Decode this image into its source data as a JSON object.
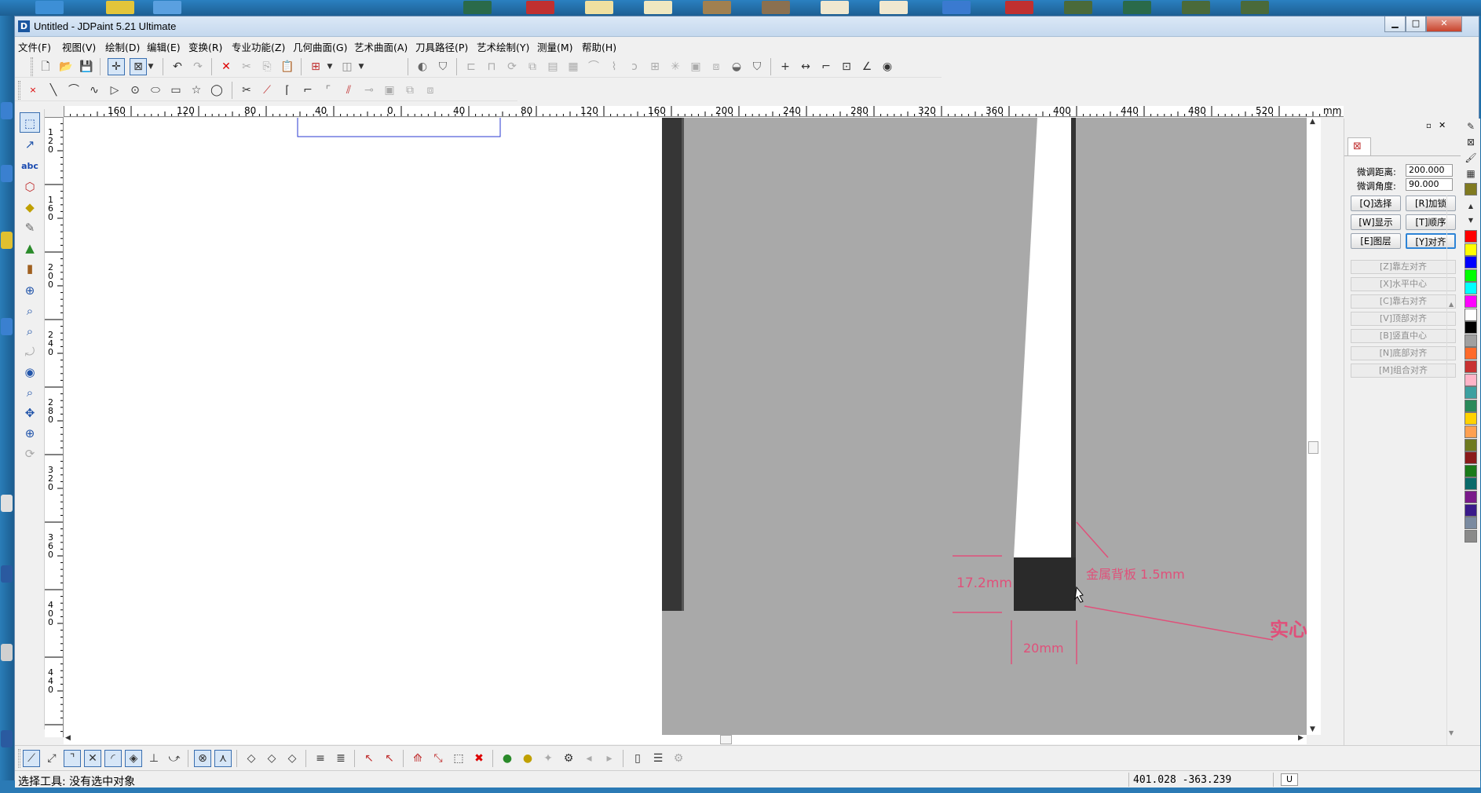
{
  "window": {
    "title": "Untitled - JDPaint 5.21 Ultimate",
    "app_icon_glyph": "D"
  },
  "menu": [
    "文件(F)",
    "视图(V)",
    "绘制(D)",
    "编辑(E)",
    "变换(R)",
    "专业功能(Z)",
    "几何曲面(G)",
    "艺术曲面(A)",
    "刀具路径(P)",
    "艺术绘制(Y)",
    "测量(M)",
    "帮助(H)"
  ],
  "ruler": {
    "h_labels": [
      "160",
      "120",
      "80",
      "40",
      "0",
      "40",
      "80",
      "120",
      "160",
      "200",
      "240",
      "280",
      "320",
      "360",
      "400",
      "440",
      "480",
      "520"
    ],
    "unit": "mm",
    "v_labels": [
      "120",
      "160",
      "200",
      "240",
      "280",
      "320",
      "360",
      "400",
      "440"
    ]
  },
  "canvas": {
    "label_height": "17.2mm",
    "label_backplate": "金属背板 1.5mm",
    "label_width": "20mm",
    "label_solid": "实心金"
  },
  "right_panel": {
    "fine_distance_label": "微调距离:",
    "fine_distance_value": "200.000",
    "fine_angle_label": "微调角度:",
    "fine_angle_value": "90.000",
    "buttons": [
      "[Q]选择",
      "[R]加锁",
      "[W]显示",
      "[T]顺序",
      "[E]图层",
      "[Y]对齐"
    ],
    "align_options": [
      "[Z]靠左对齐",
      "[X]水平中心",
      "[C]靠右对齐",
      "[V]顶部对齐",
      "[B]竖直中心",
      "[N]底部对齐",
      "[M]组合对齐"
    ]
  },
  "palette": [
    "#ff0000",
    "#ffff00",
    "#0000ff",
    "#00ff00",
    "#00ffff",
    "#ff00ff",
    "#ffffff",
    "#000000",
    "#a0a0a0",
    "#ff6a2a",
    "#c83232",
    "#ffb4c8",
    "#3ca0a0",
    "#2a8a5a",
    "#ffd200",
    "#ffa050",
    "#6e7a20",
    "#8a1a1a",
    "#1a7a1a",
    "#0a6a6a",
    "#7a1a8a",
    "#3a1a8a",
    "#7a8aa0",
    "#8a8a8a"
  ],
  "status": {
    "text": "选择工具: 没有选中对象",
    "coords": "401.028  -363.239",
    "badge": "U"
  }
}
